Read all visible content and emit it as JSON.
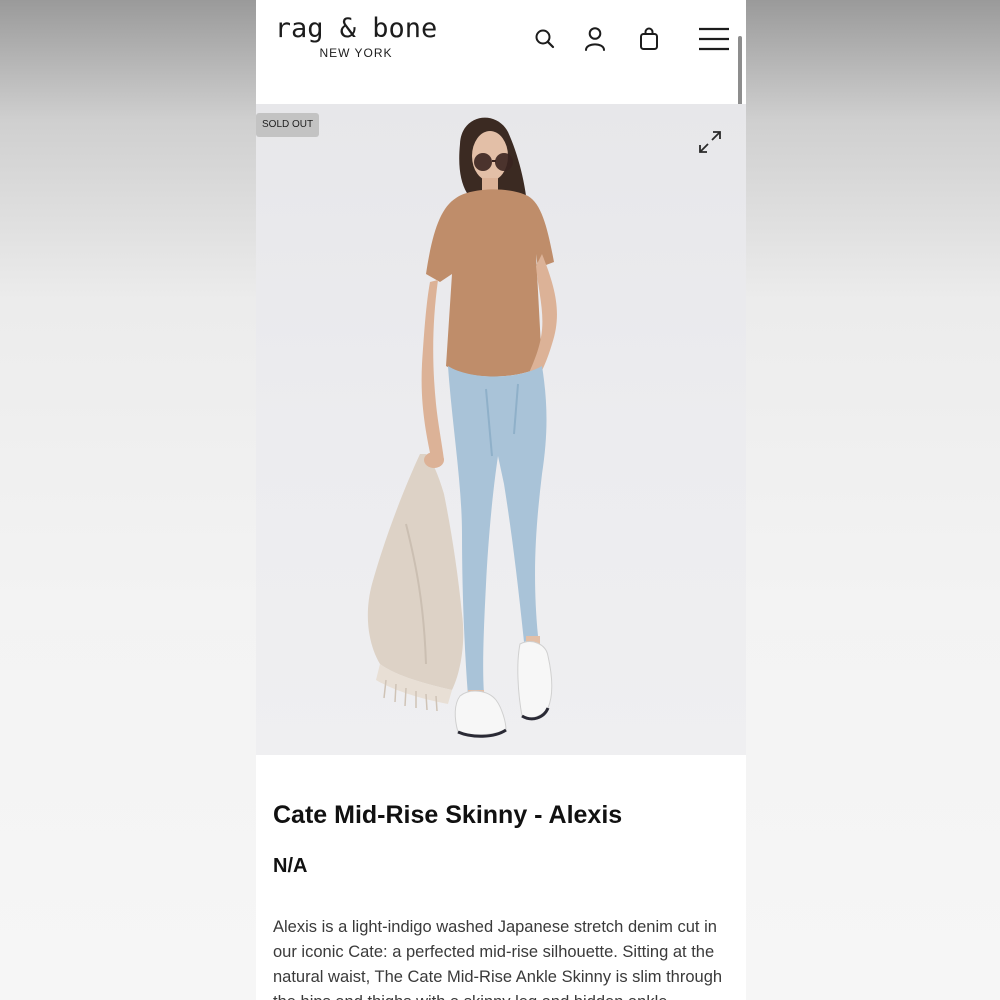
{
  "brand": {
    "name": "rag & bone",
    "location": "NEW YORK"
  },
  "header_icons": [
    "search-icon",
    "account-icon",
    "shopping-bag-icon",
    "hamburger-menu-icon"
  ],
  "product": {
    "badge": "SOLD OUT",
    "title": "Cate Mid-Rise Skinny - Alexis",
    "price": "N/A",
    "description": "Alexis is a light-indigo washed Japanese stretch denim cut in our iconic Cate: a perfected mid-rise silhouette. Sitting at the natural waist, The Cate Mid-Rise Ankle Skinny is slim through the hips and thighs with a skinny leg and hidden ankle..."
  },
  "colors": {
    "text": "#111111",
    "badge_bg": "#c3c3c3",
    "shirt": "#bf8d6a",
    "jeans": "#a9c3d8"
  }
}
